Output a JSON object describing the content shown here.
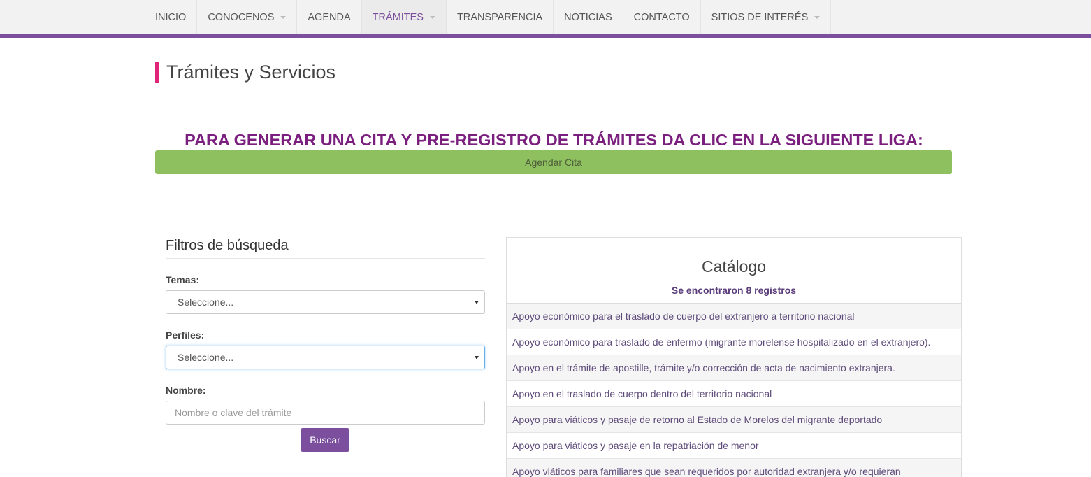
{
  "nav": {
    "items": [
      {
        "label": "INICIO"
      },
      {
        "label": "CONOCENOS"
      },
      {
        "label": "AGENDA"
      },
      {
        "label": "TRÁMITES"
      },
      {
        "label": "TRANSPARENCIA"
      },
      {
        "label": "NOTICIAS"
      },
      {
        "label": "CONTACTO"
      },
      {
        "label": "SITIOS DE INTERÉS"
      }
    ]
  },
  "page": {
    "title": "Trámites y Servicios"
  },
  "cita": {
    "heading": "PARA GENERAR UNA CITA Y PRE-REGISTRO DE TRÁMITES DA CLIC EN LA SIGUIENTE LIGA:",
    "button_label": "Agendar Cita"
  },
  "filters": {
    "title": "Filtros de búsqueda",
    "temas_label": "Temas:",
    "temas_value": "Seleccione...",
    "perfiles_label": "Perfiles:",
    "perfiles_value": "Seleccione...",
    "nombre_label": "Nombre:",
    "nombre_placeholder": "Nombre o clave del trámite",
    "search_button": "Buscar"
  },
  "catalog": {
    "title": "Catálogo",
    "count_text": "Se encontraron 8 registros",
    "rows": [
      "Apoyo económico para el traslado de cuerpo del extranjero a territorio nacional",
      "Apoyo económico para traslado de enfermo (migrante morelense hospitalizado en el extranjero).",
      "Apoyo en el trámite de apostille, trámite y/o corrección de acta de nacimiento extranjera.",
      "Apoyo en el traslado de cuerpo dentro del territorio nacional",
      "Apoyo para viáticos y pasaje de retorno al Estado de Morelos del migrante deportado",
      "Apoyo para viáticos y pasaje en la repatriación de menor",
      "Apoyo viáticos para familiares que sean requeridos por autoridad extranjera y/o requieran"
    ]
  },
  "colors": {
    "accent_purple": "#7b4f9d",
    "title_bar_pink": "#e0247a",
    "cita_green": "#8fc05f",
    "heading_purple": "#7a1f7e"
  }
}
